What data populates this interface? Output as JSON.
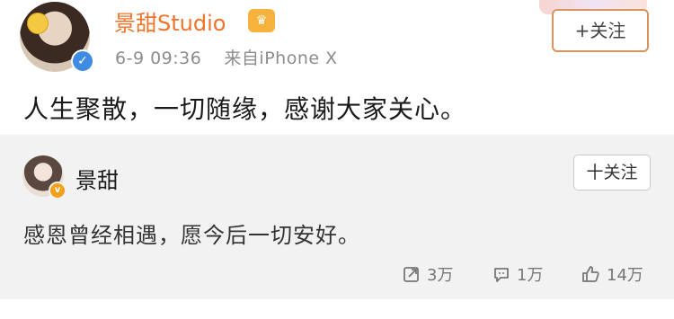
{
  "post": {
    "author": "景甜Studio",
    "time": "6-9 09:36",
    "source": "来自iPhone X",
    "follow_label": "+关注",
    "text": "人生聚散，一切随缘，感谢大家关心。"
  },
  "repost": {
    "author": "景甜",
    "follow_label": "十关注",
    "text": "感恩曾经相遇，愿今后一切安好。",
    "actions": {
      "repost_count": "3万",
      "comment_count": "1万",
      "like_count": "14万"
    }
  },
  "colors": {
    "name_orange": "#f0732a",
    "follow_border": "#d9935f",
    "verified_blue": "#3f8be2",
    "repost_bg": "#f2f2f2"
  }
}
